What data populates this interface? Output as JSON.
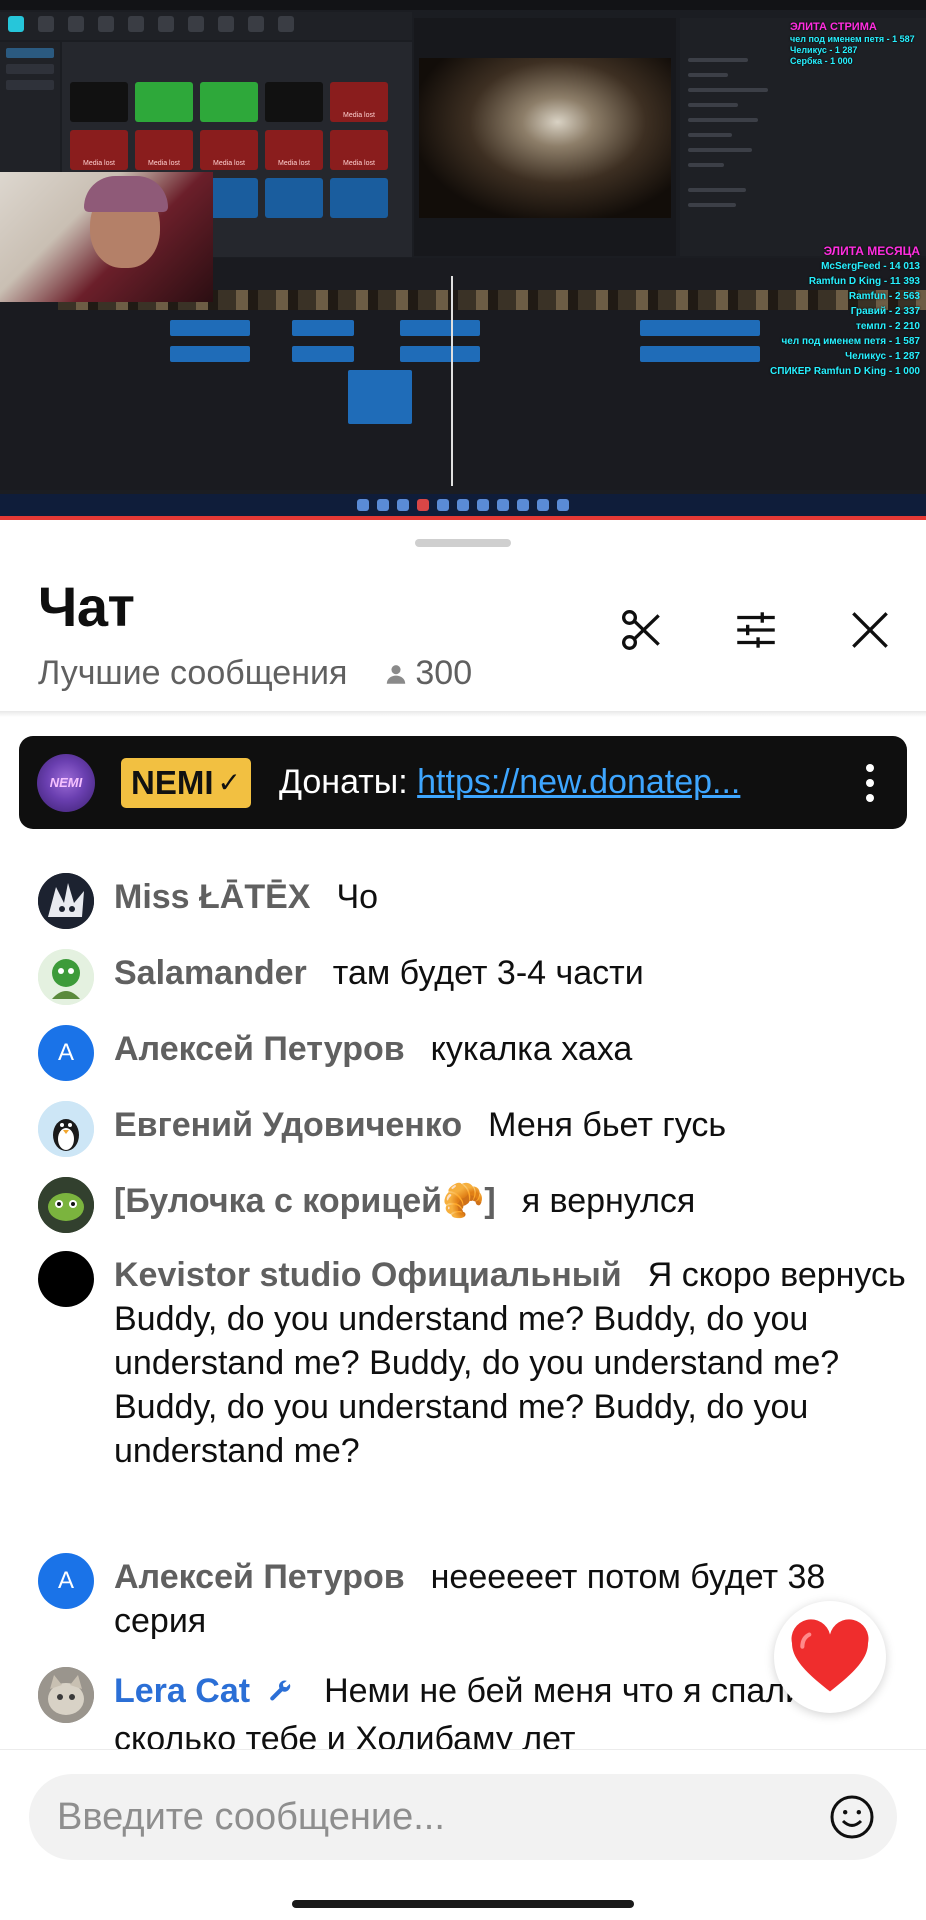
{
  "stream": {
    "overlay_top": [
      "ЭЛИТА СТРИМА",
      "чел под именем петя - 1 587",
      "Челикус - 1 287",
      "Сербка - 1 000"
    ],
    "overlay_month": [
      "ЭЛИТА МЕСЯЦА",
      "McSergFeed - 14 013",
      "Ramfun D King - 11 393",
      "Ramfun - 2 563",
      "Гравий - 2 337",
      "темпл - 2 210",
      "чел под именем петя - 1 587",
      "Челикус - 1 287",
      "СПИКЕР Ramfun D King - 1 000"
    ],
    "media_tile_label": "Media lost"
  },
  "chat": {
    "title": "Чат",
    "mode": "Лучшие сообщения",
    "viewers": "300",
    "icons": {
      "clip": "scissors-icon",
      "settings": "sliders-icon",
      "close": "close-icon",
      "viewers": "person-icon"
    }
  },
  "pinned": {
    "avatar_text": "NEMI",
    "author": "NEMI",
    "label": "Донаты: ",
    "link": "https://new.donatep..."
  },
  "messages": [
    {
      "author": "Miss ŁĀTĒX",
      "text": "Чо"
    },
    {
      "author": "Salamander",
      "text": "там будет 3-4 части"
    },
    {
      "author": "Алексей Петуров",
      "text": "кукалка хаха",
      "avatar_letter": "А"
    },
    {
      "author": "Евгений Удовиченко",
      "text": "Меня бьет гусь"
    },
    {
      "author": "[Булочка с корицей🥐]",
      "text": "я вернулся"
    },
    {
      "author": "Kevistor studio Официальный",
      "text": "Я скоро вернусь Buddy, do you understand me? Buddy, do you understand me? Buddy, do you understand me? Buddy, do you understand me? Buddy, do you understand me?"
    },
    {
      "author": "Алексей Петуров",
      "text": "неееееет потом будет 38 серия",
      "avatar_letter": "А"
    },
    {
      "author": "Lera Cat",
      "text": "Неми не бей меня что я спалила сколько тебе и Холибаму лет",
      "moderator": true
    }
  ],
  "reaction": {
    "emoji": "heart-icon",
    "color": "#ef2d2d"
  },
  "input": {
    "placeholder": "Введите сообщение..."
  },
  "colors": {
    "accent_link": "#3ea6ff",
    "badge": "#f2c041",
    "moderator_name": "#2b6fd6",
    "avatar_blue": "#1a73e8"
  }
}
